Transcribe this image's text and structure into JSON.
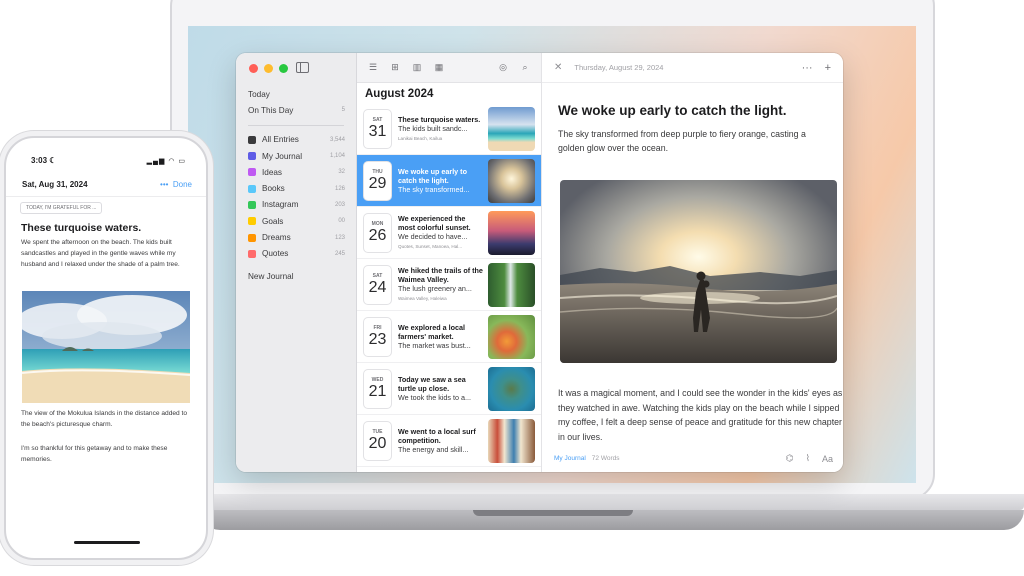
{
  "sidebar": {
    "today": "Today",
    "on_this_day": "On This Day",
    "on_this_day_count": "5",
    "journals": [
      {
        "label": "All Entries",
        "count": "3,544",
        "color": "#3a3a3c"
      },
      {
        "label": "My Journal",
        "count": "1,104",
        "color": "#5e5ce6"
      },
      {
        "label": "Ideas",
        "count": "32",
        "color": "#bf5af2"
      },
      {
        "label": "Books",
        "count": "126",
        "color": "#5ac8fa"
      },
      {
        "label": "Instagram",
        "count": "203",
        "color": "#34c759"
      },
      {
        "label": "Goals",
        "count": "00",
        "color": "#ffcc00"
      },
      {
        "label": "Dreams",
        "count": "123",
        "color": "#ff9500"
      },
      {
        "label": "Quotes",
        "count": "245",
        "color": "#ff6b6b"
      }
    ],
    "new_journal": "New Journal"
  },
  "list": {
    "month": "August 2024",
    "entries": [
      {
        "dow": "SAT",
        "day": "31",
        "title": "These turquoise waters.",
        "body": "The kids built sandc...",
        "meta": "Lanikai Beach, Kailua",
        "thumb": "beach"
      },
      {
        "dow": "THU",
        "day": "29",
        "title": "We woke up early to catch the light.",
        "body": "The sky transformed...",
        "meta": "",
        "thumb": "sunrise",
        "selected": true
      },
      {
        "dow": "MON",
        "day": "26",
        "title": "We experienced the most colorful sunset.",
        "body": "We decided to have...",
        "meta": "Quotes, Sunset, Manoea, Hal...",
        "thumb": "palms"
      },
      {
        "dow": "SAT",
        "day": "24",
        "title": "We hiked the trails of the Waimea Valley.",
        "body": "The lush greenery an...",
        "meta": "Waimea Valley, Haleiwa",
        "thumb": "waterfall"
      },
      {
        "dow": "FRI",
        "day": "23",
        "title": "We explored a local farmers' market.",
        "body": "The market was bust...",
        "meta": "",
        "thumb": "market"
      },
      {
        "dow": "WED",
        "day": "21",
        "title": "Today we saw a sea turtle up close.",
        "body": "We took the kids to a...",
        "meta": "",
        "thumb": "turtle"
      },
      {
        "dow": "TUE",
        "day": "20",
        "title": "We went to a local surf competition.",
        "body": "The energy and skill...",
        "meta": "",
        "thumb": "surf"
      }
    ]
  },
  "detail": {
    "date": "Thursday, August 29, 2024",
    "title": "We woke up early to catch the light.",
    "paragraph1": "The sky transformed from deep purple to fiery orange, casting a golden glow over the ocean.",
    "paragraph2": "It was a magical moment, and I could see the wonder in the kids' eyes as they watched in awe. Watching the kids play on the beach while I sipped my coffee, I felt a deep sense of peace and gratitude for this new chapter in our lives.",
    "journal": "My Journal",
    "words": "72 Words",
    "font_btn": "Aa"
  },
  "phone": {
    "time": "3:03",
    "date": "Sat, Aug 31, 2024",
    "done": "Done",
    "prompt": "TODAY, I'M GRATEFUL FOR ...",
    "title": "These turquoise waters.",
    "body1": "We spent the afternoon on the beach. The kids built sandcastles and played in the gentle waves while my husband and I relaxed under the shade of a palm tree.",
    "body2": "The view of the Mokulua Islands in the distance added to the beach's picturesque charm.",
    "body3": "I'm so thankful for this getaway and to make these memories."
  }
}
